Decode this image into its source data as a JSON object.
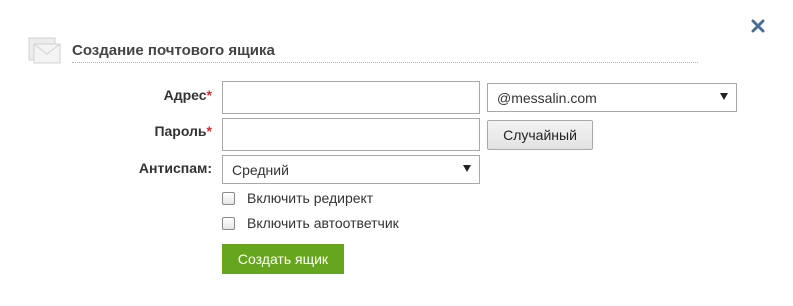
{
  "dialog": {
    "title": "Создание почтового ящика",
    "close_icon": "close-icon",
    "header_icon": "mail-icon"
  },
  "form": {
    "address": {
      "label": "Адрес",
      "required_mark": "*",
      "value": "",
      "domain_selected": "@messalin.com"
    },
    "password": {
      "label": "Пароль",
      "required_mark": "*",
      "value": "",
      "random_button": "Случайный"
    },
    "antispam": {
      "label": "Антиспам:",
      "selected": "Средний"
    },
    "redirect_checkbox": {
      "label": "Включить редирект",
      "checked": false
    },
    "autoresponder_checkbox": {
      "label": "Включить автоответчик",
      "checked": false
    },
    "submit_button": "Создать ящик"
  },
  "colors": {
    "submit_bg": "#66a61e",
    "close_icon": "#4a6f96",
    "required": "#d22b2b"
  }
}
